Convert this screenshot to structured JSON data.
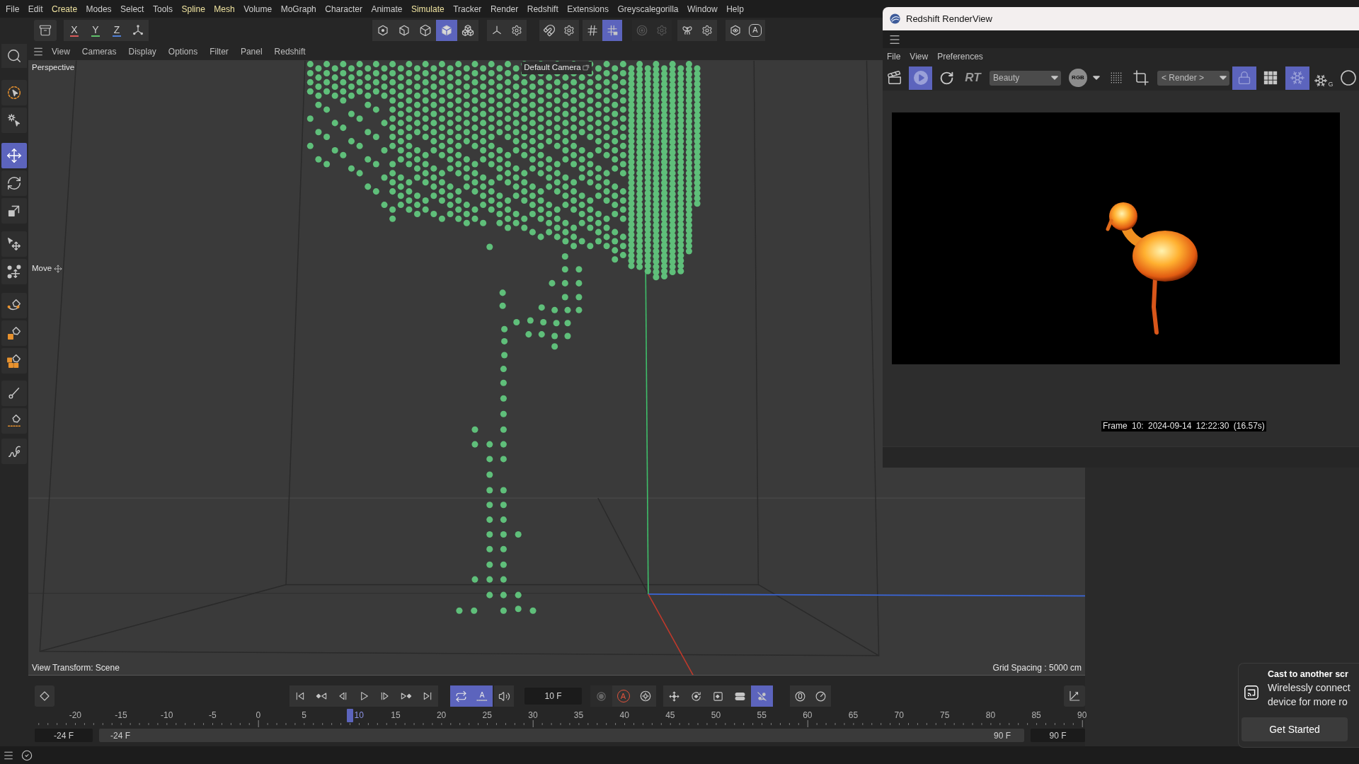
{
  "menu_bar": [
    {
      "label": "File",
      "highlighted": false
    },
    {
      "label": "Edit",
      "highlighted": false
    },
    {
      "label": "Create",
      "highlighted": true
    },
    {
      "label": "Modes",
      "highlighted": false
    },
    {
      "label": "Select",
      "highlighted": false
    },
    {
      "label": "Tools",
      "highlighted": false
    },
    {
      "label": "Spline",
      "highlighted": true
    },
    {
      "label": "Mesh",
      "highlighted": true
    },
    {
      "label": "Volume",
      "highlighted": false
    },
    {
      "label": "MoGraph",
      "highlighted": false
    },
    {
      "label": "Character",
      "highlighted": false
    },
    {
      "label": "Animate",
      "highlighted": false
    },
    {
      "label": "Simulate",
      "highlighted": true
    },
    {
      "label": "Tracker",
      "highlighted": false
    },
    {
      "label": "Render",
      "highlighted": false
    },
    {
      "label": "Redshift",
      "highlighted": false
    },
    {
      "label": "Extensions",
      "highlighted": false
    },
    {
      "label": "Greyscalegorilla",
      "highlighted": false
    },
    {
      "label": "Window",
      "highlighted": false
    },
    {
      "label": "Help",
      "highlighted": false
    }
  ],
  "toolbar": {
    "axis_buttons": [
      {
        "label": "X",
        "color": "#d65a5a"
      },
      {
        "label": "Y",
        "color": "#5fbf6a"
      },
      {
        "label": "Z",
        "color": "#4f7fd6"
      }
    ],
    "mode_buttons": [
      {
        "selected": false
      },
      {
        "selected": false
      },
      {
        "selected": false
      },
      {
        "selected": true
      },
      {
        "selected": false
      }
    ],
    "snap_buttons": [
      {
        "selected": false
      },
      {
        "selected": true
      }
    ],
    "circle_buttons": [
      {
        "disabled": true
      },
      {
        "disabled": true
      }
    ],
    "hexagon_letter": "A"
  },
  "tools": [
    {
      "selected": false
    },
    {
      "selected": false
    },
    {
      "selected": true
    },
    {
      "selected": false
    },
    {
      "selected": false
    },
    {
      "selected": false
    },
    {
      "selected": false
    },
    {
      "selected": false
    },
    {
      "selected": false
    },
    {
      "selected": false
    },
    {
      "selected": false
    },
    {
      "selected": false
    },
    {
      "selected": false
    }
  ],
  "viewport": {
    "menu": [
      "View",
      "Cameras",
      "Display",
      "Options",
      "Filter",
      "Panel",
      "Redshift"
    ],
    "camera_view": "Perspective",
    "camera": "Default Camera",
    "tool_label": "Move",
    "view_transform": "View Transform: Scene",
    "grid_spacing": "Grid Spacing : 5000 cm"
  },
  "render_view": {
    "title": "Redshift RenderView",
    "menu": [
      "File",
      "View",
      "Preferences"
    ],
    "play": {
      "selected": true
    },
    "mode_label": "RT",
    "aov": "Beauty",
    "channel": "RGB",
    "camera": "< Render >",
    "lock": {
      "selected": true
    },
    "freeze": {
      "selected": true
    },
    "freeze_letter": "G",
    "frame_info": "Frame 10: 2024-09-14 12:22:30 (16.57s)"
  },
  "timeline": {
    "loop": {
      "selected": true
    },
    "preview_range": {
      "selected": true,
      "label": "A"
    },
    "current_frame": "10 F",
    "record_buttons": [
      {
        "disabled": true
      },
      {
        "disabled": false,
        "label": "A"
      },
      {
        "disabled": false
      }
    ],
    "key_buttons": [
      {
        "selected": false
      },
      {
        "selected": false
      },
      {
        "selected": false
      },
      {
        "selected": false
      },
      {
        "selected": true
      }
    ],
    "ruler": [
      {
        "label": "-20",
        "selected": false
      },
      {
        "label": "-15",
        "selected": false
      },
      {
        "label": "-10",
        "selected": false
      },
      {
        "label": "-5",
        "selected": false
      },
      {
        "label": "0",
        "selected": false
      },
      {
        "label": "5",
        "selected": false
      },
      {
        "label": "10",
        "selected": true
      },
      {
        "label": "15",
        "selected": false
      },
      {
        "label": "20",
        "selected": false
      },
      {
        "label": "25",
        "selected": false
      },
      {
        "label": "30",
        "selected": false
      },
      {
        "label": "35",
        "selected": false
      },
      {
        "label": "40",
        "selected": false
      },
      {
        "label": "45",
        "selected": false
      },
      {
        "label": "50",
        "selected": false
      },
      {
        "label": "55",
        "selected": false
      },
      {
        "label": "60",
        "selected": false
      },
      {
        "label": "65",
        "selected": false
      },
      {
        "label": "70",
        "selected": false
      },
      {
        "label": "75",
        "selected": false
      },
      {
        "label": "80",
        "selected": false
      },
      {
        "label": "85",
        "selected": false
      },
      {
        "label": "90",
        "selected": false
      }
    ],
    "range": {
      "min_field": "-24 F",
      "start": "-24 F",
      "end": "90 F",
      "max_field": "90 F"
    }
  },
  "notification": {
    "title": "Cast to another scr",
    "body": "Wirelessly connect device for more ro",
    "button": "Get Started"
  }
}
